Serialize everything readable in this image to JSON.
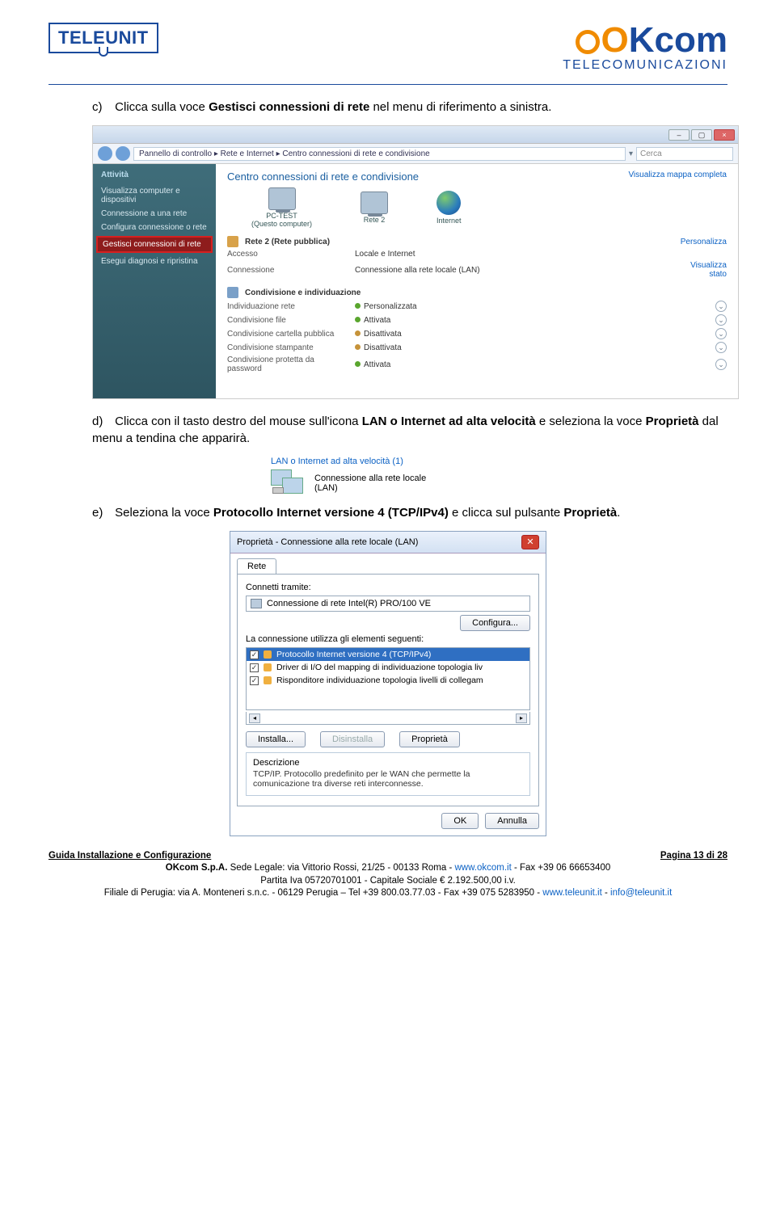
{
  "header": {
    "logo_left": "TELEUNIT",
    "logo_right_main": "Kcom",
    "logo_right_sub": "TELECOMUNICAZIONI"
  },
  "instructions": {
    "c_marker": "c)",
    "c_pre": "Clicca sulla voce ",
    "c_bold": "Gestisci connessioni di rete",
    "c_post": " nel menu di riferimento a sinistra.",
    "d_marker": "d)",
    "d_pre": "Clicca con il tasto destro del mouse sull'icona ",
    "d_bold1": "LAN o Internet ad alta velocità",
    "d_mid": " e seleziona la voce ",
    "d_bold2": "Proprietà",
    "d_post": " dal menu a tendina che apparirà.",
    "e_marker": "e)",
    "e_pre": "Seleziona la voce ",
    "e_bold1": "Protocollo Internet versione 4 (TCP/IPv4)",
    "e_mid": " e clicca sul pulsante ",
    "e_bold2": "Proprietà",
    "e_post": "."
  },
  "shot1": {
    "breadcrumb": "Pannello di controllo  ▸  Rete e Internet  ▸  Centro connessioni di rete e condivisione",
    "search_placeholder": "Cerca",
    "side_header": "Attività",
    "side_items": [
      "Visualizza computer e dispositivi",
      "Connessione a una rete",
      "Configura connessione o rete",
      "Gestisci connessioni di rete",
      "Esegui diagnosi e ripristina"
    ],
    "main_title": "Centro connessioni di rete e condivisione",
    "map_link": "Visualizza mappa completa",
    "node_pc": "PC-TEST",
    "node_pc_sub": "(Questo computer)",
    "node_net": "Rete 2",
    "node_inet": "Internet",
    "net_badge": "Rete 2 (Rete pubblica)",
    "personalizza": "Personalizza",
    "row_accesso_lab": "Accesso",
    "row_accesso_val": "Locale e Internet",
    "row_conn_lab": "Connessione",
    "row_conn_val": "Connessione alla rete locale (LAN)",
    "visualizza_stato": "Visualizza stato",
    "sharing_title": "Condivisione e individuazione",
    "rows": [
      {
        "lab": "Individuazione rete",
        "val": "Personalizzata",
        "on": true
      },
      {
        "lab": "Condivisione file",
        "val": "Attivata",
        "on": true
      },
      {
        "lab": "Condivisione cartella pubblica",
        "val": "Disattivata",
        "on": false
      },
      {
        "lab": "Condivisione stampante",
        "val": "Disattivata",
        "on": false
      },
      {
        "lab": "Condivisione protetta da password",
        "val": "Attivata",
        "on": true
      }
    ]
  },
  "shot2": {
    "group": "LAN o Internet ad alta velocità (1)",
    "line1": "Connessione alla rete locale",
    "line2": "(LAN)"
  },
  "shot3": {
    "title": "Proprietà - Connessione alla rete locale (LAN)",
    "tab": "Rete",
    "connect_label": "Connetti tramite:",
    "adapter": "Connessione di rete Intel(R) PRO/100 VE",
    "configure": "Configura...",
    "uses_label": "La connessione utilizza gli elementi seguenti:",
    "items": [
      "Protocollo Internet versione 4 (TCP/IPv4)",
      "Driver di I/O del mapping di individuazione topologia liv",
      "Risponditore individuazione topologia livelli di collegam"
    ],
    "install": "Installa...",
    "uninstall": "Disinstalla",
    "properties": "Proprietà",
    "desc_label": "Descrizione",
    "desc_text": "TCP/IP. Protocollo predefinito per le WAN che permette la comunicazione tra diverse reti interconnesse.",
    "ok": "OK",
    "cancel": "Annulla"
  },
  "footer": {
    "left": "Guida Installazione e Configurazione",
    "right": "Pagina 13 di 28",
    "l1_pre": "OKcom S.p.A.",
    "l1_rest": " Sede Legale: via Vittorio Rossi, 21/25 - 00133 Roma - ",
    "l1_link": "www.okcom.it",
    "l1_end": " - Fax +39 06 66653400",
    "l2": "Partita Iva 05720701001 - Capitale Sociale € 2.192.500,00 i.v.",
    "l3_pre": "Filiale di Perugia: via A. Monteneri s.n.c. - 06129 Perugia – Tel +39 800.03.77.03 - Fax +39 075 5283950 - ",
    "l3_link1": "www.teleunit.it",
    "l3_mid": " - ",
    "l3_link2": "info@teleunit.it"
  }
}
